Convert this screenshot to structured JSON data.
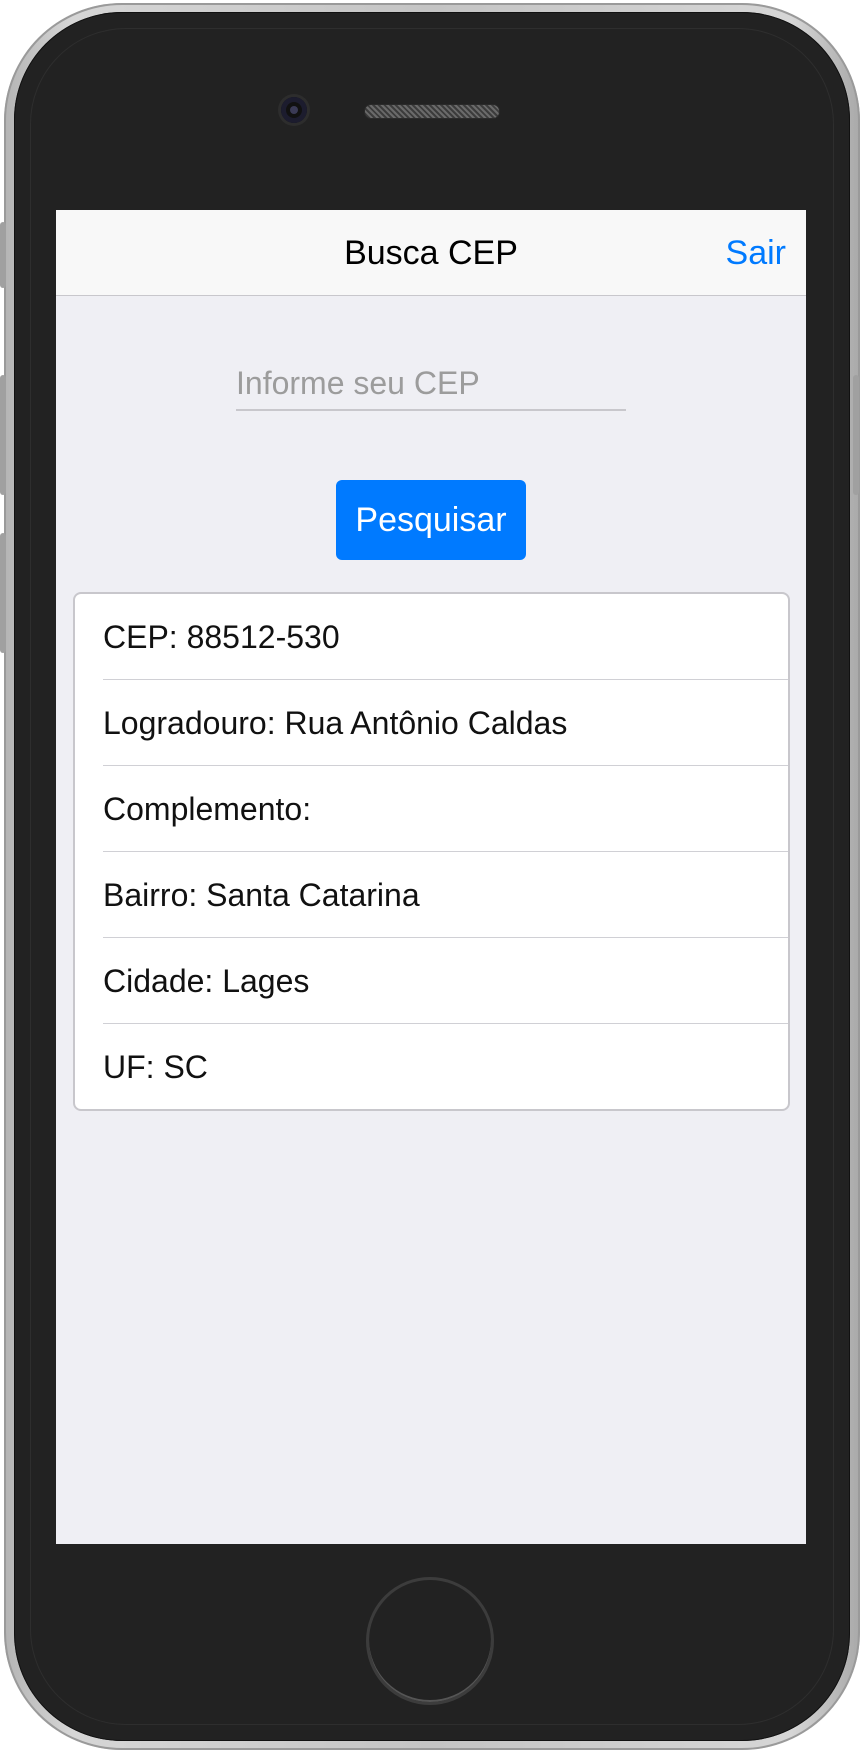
{
  "nav": {
    "title": "Busca CEP",
    "action_label": "Sair"
  },
  "search": {
    "placeholder": "Informe seu CEP",
    "value": "",
    "button_label": "Pesquisar"
  },
  "result": {
    "rows": [
      "CEP: 88512-530",
      "Logradouro: Rua Antônio Caldas",
      "Complemento:",
      "Bairro: Santa Catarina",
      "Cidade: Lages",
      "UF: SC"
    ]
  },
  "colors": {
    "accent": "#007aff",
    "screen_background": "#efeff4",
    "nav_background": "#f8f8f8",
    "phone_body": "#222222"
  },
  "icons": {
    "camera": "camera-icon",
    "speaker": "speaker-icon",
    "home": "home-button-icon"
  }
}
